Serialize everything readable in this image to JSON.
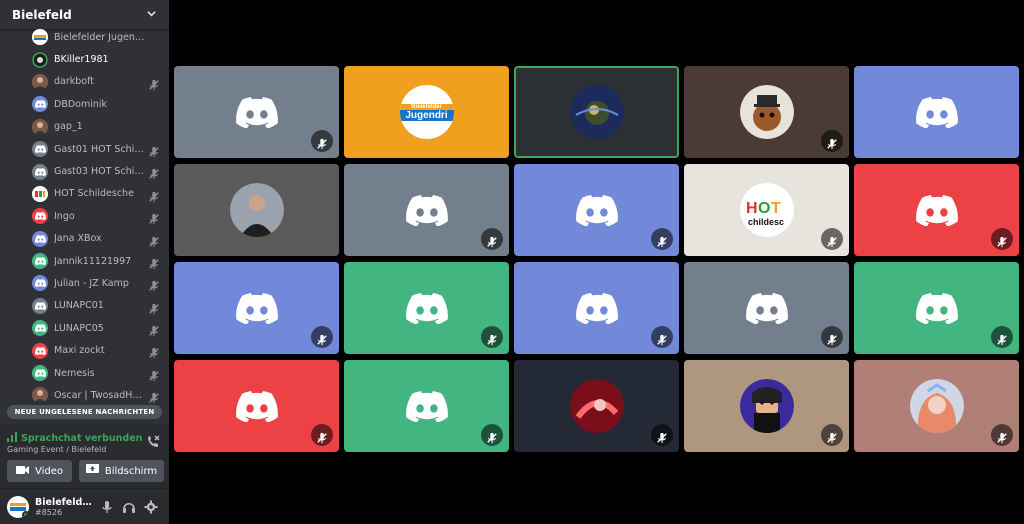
{
  "server": {
    "name": "Bielefeld"
  },
  "members": [
    {
      "name": "Bielefelder Jugendring",
      "avatar": "jugendring-logo",
      "color": "#ffffff",
      "muted": false,
      "active": false
    },
    {
      "name": "BKiller1981",
      "avatar": "ring-avatar",
      "color": "#2f3136",
      "muted": false,
      "active": true
    },
    {
      "name": "darkboft",
      "avatar": "photo-avatar",
      "color": "#a0522d",
      "muted": true,
      "active": false
    },
    {
      "name": "DBDominik",
      "avatar": "discord-logo",
      "color": "#7289da",
      "muted": false,
      "active": false
    },
    {
      "name": "gap_1",
      "avatar": "photo-avatar",
      "color": "#555555",
      "muted": false,
      "active": false
    },
    {
      "name": "Gast01 HOT Schild...",
      "avatar": "discord-logo",
      "color": "#747f8d",
      "muted": true,
      "active": false
    },
    {
      "name": "Gast03 HOT Schild...",
      "avatar": "discord-logo",
      "color": "#747f8d",
      "muted": true,
      "active": false
    },
    {
      "name": "HOT Schildesche",
      "avatar": "hot-logo",
      "color": "#e8e6df",
      "muted": true,
      "active": false
    },
    {
      "name": "Ingo",
      "avatar": "discord-logo",
      "color": "#ed4245",
      "muted": true,
      "active": false
    },
    {
      "name": "Jana XBox",
      "avatar": "discord-logo",
      "color": "#7289da",
      "muted": true,
      "active": false
    },
    {
      "name": "Jannik11121997",
      "avatar": "discord-logo",
      "color": "#43b581",
      "muted": true,
      "active": false
    },
    {
      "name": "Julian - JZ Kamp",
      "avatar": "discord-logo",
      "color": "#7289da",
      "muted": true,
      "active": false
    },
    {
      "name": "LUNAPC01",
      "avatar": "discord-logo",
      "color": "#747f8d",
      "muted": true,
      "active": false
    },
    {
      "name": "LUNAPC05",
      "avatar": "discord-logo",
      "color": "#43b581",
      "muted": true,
      "active": false
    },
    {
      "name": "Maxi zockt",
      "avatar": "discord-logo",
      "color": "#ed4245",
      "muted": true,
      "active": false
    },
    {
      "name": "Nemesis",
      "avatar": "discord-logo",
      "color": "#43b581",
      "muted": true,
      "active": false
    },
    {
      "name": "Oscar | TwosadHu...",
      "avatar": "photo-avatar",
      "color": "#c0392b",
      "muted": true,
      "active": false
    }
  ],
  "unread_label": "NEUE UNGELESENE NACHRICHTEN",
  "voice": {
    "status": "Sprachchat verbunden",
    "channel": "Gaming Event / Bielefeld",
    "video_label": "Video",
    "screen_label": "Bildschirm"
  },
  "user": {
    "name": "Bielefelder J...",
    "tag": "#8526"
  },
  "colors": {
    "grey": "#747f8d",
    "blurple": "#7289da",
    "green": "#43b581",
    "red": "#ed4245",
    "orange": "#f0a01e",
    "dark": "#2c2f33",
    "brown": "#4a3b35",
    "beige": "#ae967f",
    "rose": "#b07f75"
  },
  "tiles": [
    {
      "kind": "logo",
      "bg": "#747f8d",
      "muted": true,
      "avatar": "discord-logo"
    },
    {
      "kind": "photo",
      "bg": "#f0a01e",
      "muted": false,
      "avatar": "jugendring-logo",
      "logo_text": "Bielefelder",
      "logo_text2": "Jugendri"
    },
    {
      "kind": "photo",
      "bg": "#2c2f33",
      "muted": false,
      "avatar": "planet-avatar",
      "speaking": true
    },
    {
      "kind": "photo",
      "bg": "#4a3b35",
      "muted": true,
      "avatar": "bear-avatar"
    },
    {
      "kind": "logo",
      "bg": "#7289da",
      "muted": false,
      "avatar": "discord-logo"
    },
    {
      "kind": "photo",
      "bg": "#5a5a5a",
      "muted": false,
      "avatar": "person-avatar"
    },
    {
      "kind": "logo",
      "bg": "#747f8d",
      "muted": true,
      "avatar": "discord-logo"
    },
    {
      "kind": "logo",
      "bg": "#7289da",
      "muted": true,
      "avatar": "discord-logo"
    },
    {
      "kind": "photo",
      "bg": "#e6e4dc",
      "muted": true,
      "avatar": "hot-logo",
      "logo_text": "HOT",
      "logo_text2": "childesc"
    },
    {
      "kind": "logo",
      "bg": "#ed4245",
      "muted": true,
      "avatar": "discord-logo"
    },
    {
      "kind": "logo",
      "bg": "#7289da",
      "muted": true,
      "avatar": "discord-logo"
    },
    {
      "kind": "logo",
      "bg": "#43b581",
      "muted": true,
      "avatar": "discord-logo"
    },
    {
      "kind": "logo",
      "bg": "#7289da",
      "muted": true,
      "avatar": "discord-logo"
    },
    {
      "kind": "logo",
      "bg": "#747f8d",
      "muted": true,
      "avatar": "discord-logo"
    },
    {
      "kind": "logo",
      "bg": "#43b581",
      "muted": true,
      "avatar": "discord-logo"
    },
    {
      "kind": "logo",
      "bg": "#ed4245",
      "muted": true,
      "avatar": "discord-logo"
    },
    {
      "kind": "logo",
      "bg": "#43b581",
      "muted": true,
      "avatar": "discord-logo"
    },
    {
      "kind": "photo",
      "bg": "#232a36",
      "muted": true,
      "avatar": "crimson-avatar"
    },
    {
      "kind": "photo",
      "bg": "#ae967f",
      "muted": true,
      "avatar": "roblox-avatar"
    },
    {
      "kind": "photo",
      "bg": "#b07f75",
      "muted": true,
      "avatar": "girl-avatar"
    }
  ]
}
